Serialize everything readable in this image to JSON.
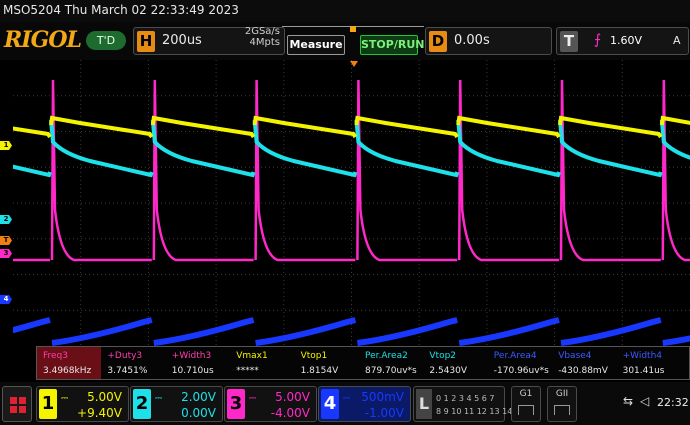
{
  "header": {
    "title": "MSO5204  Thu March 02 22:33:49 2023",
    "logo": "RIGOL",
    "trigger_status": "T'D",
    "horizontal": {
      "key": "H",
      "timebase": "200us",
      "sample_rate": "2GSa/s",
      "memory_depth": "4Mpts"
    },
    "measure_label": "Measure",
    "run_label": "STOP/RUN",
    "delay": {
      "key": "D",
      "value": "0.00s"
    },
    "trigger": {
      "key": "T",
      "level": "1.60V",
      "mode": "A"
    }
  },
  "colors": {
    "ch1": "#f4f400",
    "ch2": "#1de0e8",
    "ch3": "#ff28c8",
    "ch4": "#1838ff",
    "trigger": "#f08010"
  },
  "measurements": [
    {
      "name": "Freq3",
      "value": "3.4968kHz",
      "color": "#ff3fae",
      "selected": true
    },
    {
      "name": "+Duty3",
      "value": "3.7451%",
      "color": "#ff3fae"
    },
    {
      "name": "+Width3",
      "value": "10.710us",
      "color": "#ff3fae"
    },
    {
      "name": "Vmax1",
      "value": "*****",
      "color": "#f4f400"
    },
    {
      "name": "Vtop1",
      "value": "1.8154V",
      "color": "#f4f400"
    },
    {
      "name": "Per.Area2",
      "value": "879.70uv*s",
      "color": "#1de0e8"
    },
    {
      "name": "Vtop2",
      "value": "2.5430V",
      "color": "#1de0e8"
    },
    {
      "name": "Per.Area4",
      "value": "-170.96uv*s",
      "color": "#3a5cff"
    },
    {
      "name": "Vbase4",
      "value": "-430.88mV",
      "color": "#3a5cff"
    },
    {
      "name": "+Width4",
      "value": "301.41us",
      "color": "#3a5cff"
    }
  ],
  "channels": [
    {
      "num": "1",
      "scale": "5.00V",
      "offset": "+9.40V",
      "color": "#f4f400"
    },
    {
      "num": "2",
      "scale": "2.00V",
      "offset": "0.00V",
      "color": "#1de0e8"
    },
    {
      "num": "3",
      "scale": "5.00V",
      "offset": "-4.00V",
      "color": "#ff28c8"
    },
    {
      "num": "4",
      "scale": "500mV",
      "offset": "-1.00V",
      "color": "#1838ff"
    }
  ],
  "logic": {
    "key": "L",
    "row1": "0 1 2 3 4 5 6 7",
    "row2": "8 9 10 11 12 13 14 15"
  },
  "generators": [
    "G1",
    "GII"
  ],
  "clock": "22:32"
}
